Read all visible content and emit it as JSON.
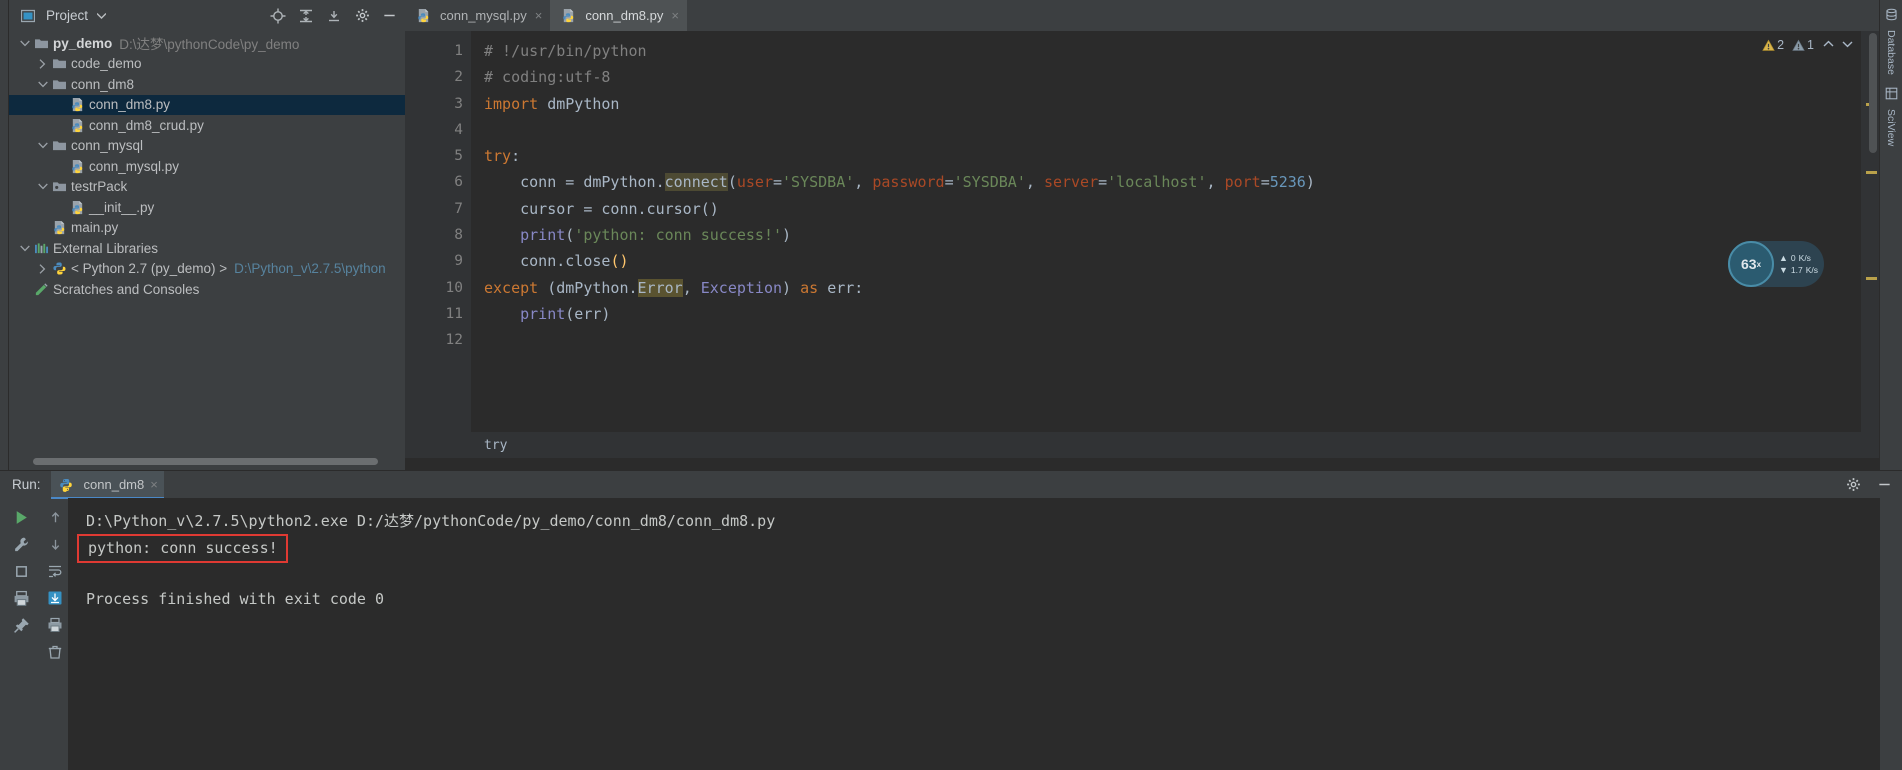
{
  "window": {
    "left_strip_label": "",
    "right_tools": [
      {
        "label": "Database",
        "icon": "database-icon"
      },
      {
        "label": "SciView",
        "icon": "sciview-icon"
      }
    ]
  },
  "project_panel": {
    "title": "Project",
    "header_icons": [
      {
        "name": "locate-target-icon"
      },
      {
        "name": "collapse-expand-icon"
      },
      {
        "name": "collapse-all-icon"
      },
      {
        "name": "gear-icon"
      },
      {
        "name": "minimize-icon"
      }
    ],
    "tree": [
      {
        "label": "py_demo",
        "path": "D:\\达梦\\pythonCode\\py_demo",
        "icon": "folder-icon",
        "arrow": "down",
        "depth": 0,
        "bold": true,
        "selected": false
      },
      {
        "label": "code_demo",
        "path": "",
        "icon": "folder-icon",
        "arrow": "right",
        "depth": 1,
        "bold": false,
        "selected": false
      },
      {
        "label": "conn_dm8",
        "path": "",
        "icon": "folder-icon",
        "arrow": "down",
        "depth": 1,
        "bold": false,
        "selected": false
      },
      {
        "label": "conn_dm8.py",
        "path": "",
        "icon": "python-file-icon",
        "arrow": "none",
        "depth": 2,
        "bold": false,
        "selected": true
      },
      {
        "label": "conn_dm8_crud.py",
        "path": "",
        "icon": "python-file-icon",
        "arrow": "none",
        "depth": 2,
        "bold": false,
        "selected": false
      },
      {
        "label": "conn_mysql",
        "path": "",
        "icon": "folder-icon",
        "arrow": "down",
        "depth": 1,
        "bold": false,
        "selected": false
      },
      {
        "label": "conn_mysql.py",
        "path": "",
        "icon": "python-file-icon",
        "arrow": "none",
        "depth": 2,
        "bold": false,
        "selected": false
      },
      {
        "label": "testrPack",
        "path": "",
        "icon": "package-folder-icon",
        "arrow": "down",
        "depth": 1,
        "bold": false,
        "selected": false
      },
      {
        "label": "__init__.py",
        "path": "",
        "icon": "python-file-icon",
        "arrow": "none",
        "depth": 2,
        "bold": false,
        "selected": false
      },
      {
        "label": "main.py",
        "path": "",
        "icon": "python-file-icon",
        "arrow": "none",
        "depth": 1,
        "bold": false,
        "selected": false
      },
      {
        "label": "External Libraries",
        "path": "",
        "icon": "library-icon",
        "arrow": "down",
        "depth": 0,
        "bold": false,
        "selected": false
      },
      {
        "label": "< Python 2.7 (py_demo) >",
        "path": "D:\\Python_v\\2.7.5\\python",
        "icon": "python-sdk-icon",
        "arrow": "right",
        "depth": 1,
        "bold": false,
        "selected": false,
        "path_blue": true
      },
      {
        "label": "Scratches and Consoles",
        "path": "",
        "icon": "scratches-icon",
        "arrow": "none",
        "depth": 0,
        "bold": false,
        "selected": false
      }
    ]
  },
  "editor": {
    "tabs": [
      {
        "label": "conn_mysql.py",
        "icon": "python-file-icon",
        "active": false,
        "close": "×"
      },
      {
        "label": "conn_dm8.py",
        "icon": "python-file-icon",
        "active": true,
        "close": "×"
      }
    ],
    "line_numbers": [
      "1",
      "2",
      "3",
      "4",
      "5",
      "6",
      "7",
      "8",
      "9",
      "10",
      "11",
      "12"
    ],
    "breadcrumb": "try",
    "inspections": {
      "warning_count": "2",
      "weak_warning_count": "1",
      "chevron_up": "⌃",
      "chevron_down": "⌄"
    },
    "code_lines": [
      {
        "n": 1,
        "tokens": [
          {
            "t": "# !/usr/bin/python",
            "c": "cm"
          }
        ]
      },
      {
        "n": 2,
        "tokens": [
          {
            "t": "# coding:utf-8",
            "c": "cm"
          }
        ]
      },
      {
        "n": 3,
        "tokens": [
          {
            "t": "import ",
            "c": "kw"
          },
          {
            "t": "dmPython",
            "c": ""
          }
        ]
      },
      {
        "n": 4,
        "tokens": []
      },
      {
        "n": 5,
        "tokens": [
          {
            "t": "try",
            "c": "kw"
          },
          {
            "t": ":",
            "c": ""
          }
        ]
      },
      {
        "n": 6,
        "tokens": [
          {
            "t": "    conn = dmPython.",
            "c": ""
          },
          {
            "t": "connect",
            "c": "hlc"
          },
          {
            "t": "(",
            "c": ""
          },
          {
            "t": "user",
            "c": "param"
          },
          {
            "t": "=",
            "c": ""
          },
          {
            "t": "'SYSDBA'",
            "c": "str"
          },
          {
            "t": ", ",
            "c": ""
          },
          {
            "t": "password",
            "c": "param"
          },
          {
            "t": "=",
            "c": ""
          },
          {
            "t": "'SYSDBA'",
            "c": "str"
          },
          {
            "t": ", ",
            "c": ""
          },
          {
            "t": "server",
            "c": "param"
          },
          {
            "t": "=",
            "c": ""
          },
          {
            "t": "'localhost'",
            "c": "str"
          },
          {
            "t": ", ",
            "c": ""
          },
          {
            "t": "port",
            "c": "param"
          },
          {
            "t": "=",
            "c": ""
          },
          {
            "t": "5236",
            "c": "num"
          },
          {
            "t": ")",
            "c": ""
          }
        ]
      },
      {
        "n": 7,
        "tokens": [
          {
            "t": "    cursor = conn.cursor()",
            "c": ""
          }
        ]
      },
      {
        "n": 8,
        "tokens": [
          {
            "t": "    ",
            "c": ""
          },
          {
            "t": "print",
            "c": "builtin"
          },
          {
            "t": "(",
            "c": ""
          },
          {
            "t": "'python: conn success!'",
            "c": "str"
          },
          {
            "t": ")",
            "c": ""
          }
        ]
      },
      {
        "n": 9,
        "tokens": [
          {
            "t": "    conn.",
            "c": ""
          },
          {
            "t": "close",
            "c": ""
          },
          {
            "t": "()",
            "c": "fn"
          }
        ]
      },
      {
        "n": 10,
        "tokens": [
          {
            "t": "except ",
            "c": "kw"
          },
          {
            "t": "(dmPython.",
            "c": ""
          },
          {
            "t": "Error",
            "c": "hlb"
          },
          {
            "t": ", ",
            "c": ""
          },
          {
            "t": "Exception",
            "c": "builtin"
          },
          {
            "t": ") ",
            "c": ""
          },
          {
            "t": "as ",
            "c": "kw"
          },
          {
            "t": "err:",
            "c": ""
          }
        ]
      },
      {
        "n": 11,
        "tokens": [
          {
            "t": "    ",
            "c": ""
          },
          {
            "t": "print",
            "c": "builtin"
          },
          {
            "t": "(err)",
            "c": ""
          }
        ]
      },
      {
        "n": 12,
        "tokens": []
      }
    ]
  },
  "network_bubble": {
    "percent": "63",
    "percent_unit": "x",
    "up_rate": "0",
    "up_unit": "K/s",
    "down_rate": "1.7",
    "down_unit": "K/s"
  },
  "run_panel": {
    "label": "Run:",
    "tab_label": "conn_dm8",
    "tab_icon": "python-icon",
    "tab_close": "×",
    "gear_icon": "gear-icon",
    "minimize_icon": "minimize-icon",
    "gutter_buttons": [
      {
        "name": "rerun-button",
        "icon": "play-icon"
      },
      {
        "name": "stop-button",
        "icon": "stop-icon"
      },
      {
        "name": "settings-button",
        "icon": "wrench-icon"
      },
      {
        "name": "print-button",
        "icon": "printer-icon"
      },
      {
        "name": "pin-tab-button",
        "icon": "pin-icon"
      },
      {
        "name": "up-stack-button",
        "icon": "arrow-up-icon"
      },
      {
        "name": "down-stack-button",
        "icon": "arrow-down-icon"
      },
      {
        "name": "soft-wrap-button",
        "icon": "wrap-lines-icon"
      },
      {
        "name": "scroll-to-end-button",
        "icon": "scroll-end-icon"
      },
      {
        "name": "clear-all-button",
        "icon": "trash-icon"
      }
    ],
    "console_lines": [
      {
        "text": "D:\\Python_v\\2.7.5\\python2.exe D:/达梦/pythonCode/py_demo/conn_dm8/conn_dm8.py",
        "highlight": false
      },
      {
        "text": "python: conn success!",
        "highlight": true
      },
      {
        "text": "",
        "highlight": false
      },
      {
        "text": "Process finished with exit code 0",
        "highlight": false
      }
    ],
    "highlight_color": "#e03a33"
  },
  "colors": {
    "bg_panel": "#3c3f41",
    "bg_editor": "#2b2b2b",
    "gutter": "#313335",
    "selection": "#0d293e",
    "accent_tab": "#4a88c7",
    "keyword": "#cc7832",
    "string": "#6a8759",
    "number": "#6897bb",
    "param": "#aa4926",
    "comment": "#808080",
    "text": "#a9b7c6"
  }
}
